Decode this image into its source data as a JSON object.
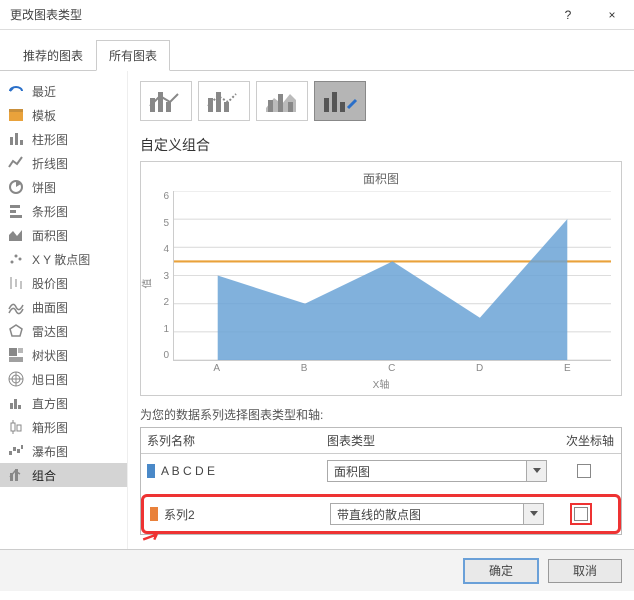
{
  "window": {
    "title": "更改图表类型",
    "help": "?",
    "close": "×"
  },
  "tabs": {
    "recommended": "推荐的图表",
    "all": "所有图表"
  },
  "sidebar": {
    "items": [
      {
        "label": "最近",
        "color": "#2a6fc9"
      },
      {
        "label": "模板",
        "color": "#e9a23b"
      },
      {
        "label": "柱形图",
        "color": "#888"
      },
      {
        "label": "折线图",
        "color": "#888"
      },
      {
        "label": "饼图",
        "color": "#888"
      },
      {
        "label": "条形图",
        "color": "#888"
      },
      {
        "label": "面积图",
        "color": "#888"
      },
      {
        "label": "X Y 散点图",
        "color": "#888"
      },
      {
        "label": "股价图",
        "color": "#888"
      },
      {
        "label": "曲面图",
        "color": "#888"
      },
      {
        "label": "雷达图",
        "color": "#888"
      },
      {
        "label": "树状图",
        "color": "#888"
      },
      {
        "label": "旭日图",
        "color": "#888"
      },
      {
        "label": "直方图",
        "color": "#888"
      },
      {
        "label": "箱形图",
        "color": "#888"
      },
      {
        "label": "瀑布图",
        "color": "#888"
      },
      {
        "label": "组合",
        "color": "#888"
      }
    ]
  },
  "main": {
    "section_title": "自定义组合",
    "series_label": "为您的数据系列选择图表类型和轴:",
    "headers": {
      "name": "系列名称",
      "type": "图表类型",
      "axis": "次坐标轴"
    },
    "series": [
      {
        "swatch": "#4a89c8",
        "name": "A B C D E",
        "type": "面积图",
        "secondary": false
      },
      {
        "swatch": "#e9813b",
        "name": "系列2",
        "type": "带直线的散点图",
        "secondary": false
      }
    ]
  },
  "chart_data": {
    "type": "area",
    "title": "面积图",
    "xlabel": "X轴",
    "ylabel": "值",
    "categories": [
      "A",
      "B",
      "C",
      "D",
      "E"
    ],
    "values": [
      3,
      2,
      3.5,
      1.5,
      5
    ],
    "ylim": [
      0,
      6
    ],
    "yticks": [
      0,
      1,
      2,
      3,
      4,
      5,
      6
    ],
    "target_line": 3.5
  },
  "footer": {
    "ok": "确定",
    "cancel": "取消"
  }
}
